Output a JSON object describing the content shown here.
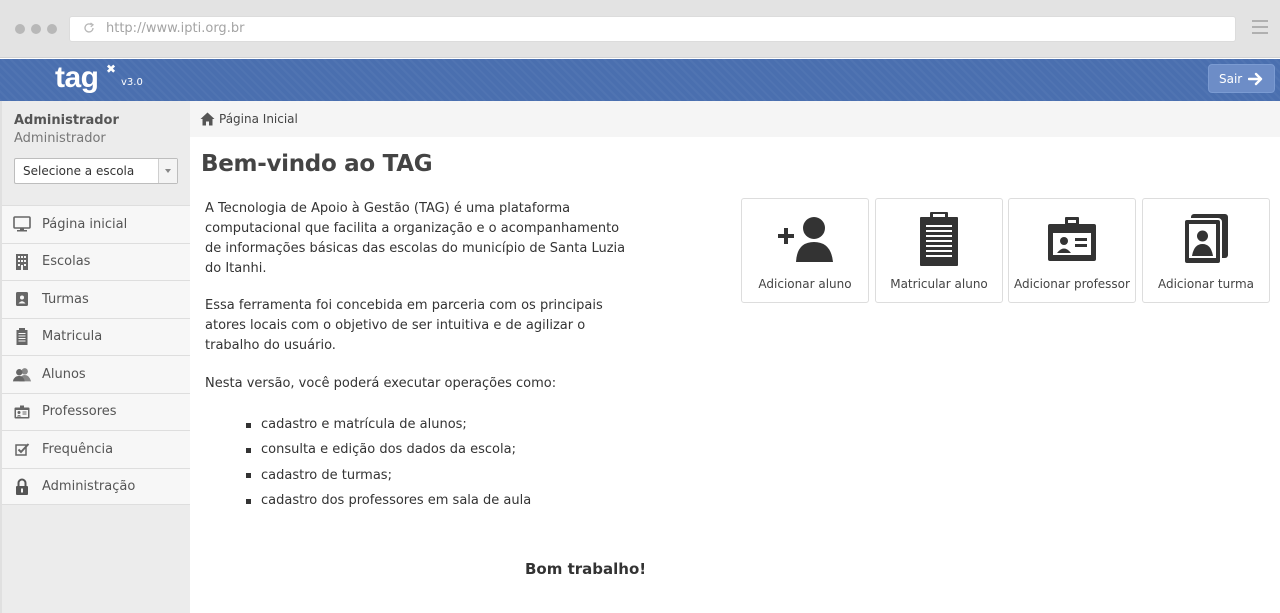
{
  "browser": {
    "url": "http://www.ipti.org.br"
  },
  "navbar": {
    "logo_text": "tag",
    "logo_mark": "✖",
    "version": "v3.0",
    "logout_label": "Sair"
  },
  "sidebar": {
    "user_name": "Administrador",
    "user_role": "Administrador",
    "school_select_value": "Selecione a escola",
    "items": [
      {
        "label": "Página inicial",
        "icon": "monitor-icon"
      },
      {
        "label": "Escolas",
        "icon": "building-icon"
      },
      {
        "label": "Turmas",
        "icon": "class-book-icon"
      },
      {
        "label": "Matricula",
        "icon": "clipboard-icon"
      },
      {
        "label": "Alunos",
        "icon": "users-icon"
      },
      {
        "label": "Professores",
        "icon": "id-card-icon"
      },
      {
        "label": "Frequência",
        "icon": "checkbox-icon"
      },
      {
        "label": "Administração",
        "icon": "lock-icon"
      }
    ]
  },
  "breadcrumb": {
    "label": "Página Inicial"
  },
  "main": {
    "title": "Bem-vindo ao TAG",
    "paragraph1": "A Tecnologia de Apoio à Gestão (TAG) é uma plataforma computacional que facilita a organização e o acompanhamento de informações básicas das escolas do município de Santa Luzia do Itanhi.",
    "paragraph2": "Essa ferramenta foi concebida em parceria com os principais atores locais com o objetivo de ser intuitiva e de agilizar o trabalho do usuário.",
    "paragraph3": "Nesta versão, você poderá executar operações como:",
    "operations": [
      "cadastro e matrícula de alunos;",
      "consulta e edição dos dados da escola;",
      "cadastro de turmas;",
      "cadastro dos professores em sala de aula"
    ],
    "closing": "Bom trabalho!"
  },
  "actions": [
    {
      "label": "Adicionar aluno",
      "icon": "add-user-icon"
    },
    {
      "label": "Matricular aluno",
      "icon": "clipboard-icon"
    },
    {
      "label": "Adicionar professor",
      "icon": "id-badge-icon"
    },
    {
      "label": "Adicionar turma",
      "icon": "class-book-icon"
    }
  ],
  "colors": {
    "navbar": "#4a6faf",
    "sidebar": "#ececec",
    "text": "#333333"
  }
}
